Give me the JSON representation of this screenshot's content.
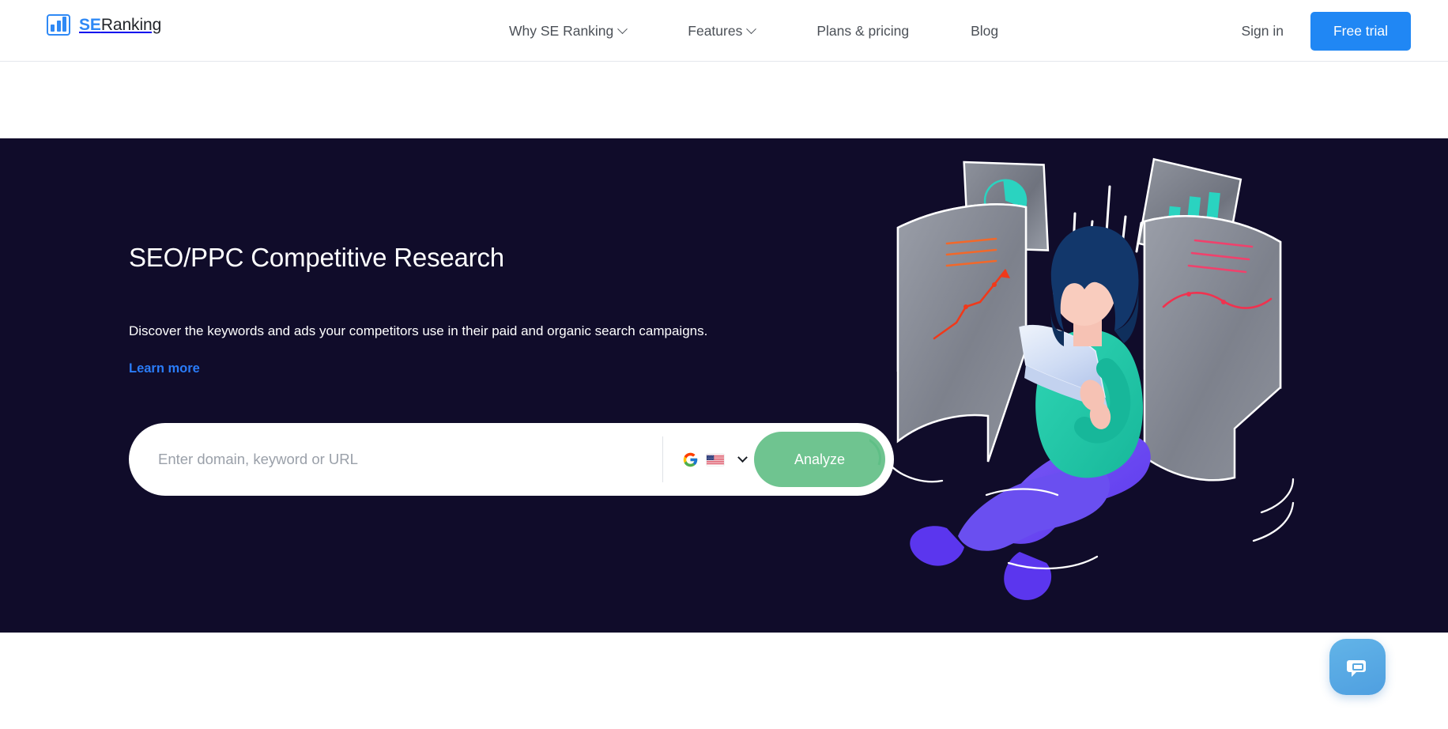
{
  "header": {
    "logo": {
      "icon": "bar-chart-logo-icon",
      "text_primary": "SE",
      "text_secondary": "Ranking"
    },
    "nav": [
      {
        "label": "Why SE Ranking",
        "has_dropdown": true
      },
      {
        "label": "Features",
        "has_dropdown": true
      },
      {
        "label": "Plans & pricing",
        "has_dropdown": false
      },
      {
        "label": "Blog",
        "has_dropdown": false
      }
    ],
    "sign_in_label": "Sign in",
    "free_trial_label": "Free trial",
    "free_trial_color": "#2087f4"
  },
  "hero": {
    "background_color": "#100c2a",
    "title": "SEO/PPC Competitive Research",
    "subtitle": "Discover the keywords and ads your competitors use in their paid and organic search campaigns.",
    "learn_more_label": "Learn more",
    "learn_more_color": "#2a7cf8"
  },
  "search": {
    "placeholder": "Enter domain, keyword or URL",
    "value": "",
    "engine_icon": "google-icon",
    "country_flag": "us-flag-icon",
    "dropdown_icon": "chevron-down-icon",
    "analyze_label": "Analyze",
    "analyze_color": "#6fc490"
  },
  "illustration": {
    "name": "woman-with-laptop-and-charts-illustration",
    "colors": {
      "hair": "#12376b",
      "skin": "#f6c2b4",
      "sweater": "#21c7a8",
      "pants": "#6a4ff0",
      "paper": "#8d919b",
      "accent_orange": "#f2682a",
      "accent_pink": "#f0416c",
      "accent_teal": "#2ad3c0"
    }
  },
  "chat": {
    "icon": "chat-bubble-icon",
    "color_start": "#62b4e8",
    "color_end": "#4f9fe0"
  }
}
